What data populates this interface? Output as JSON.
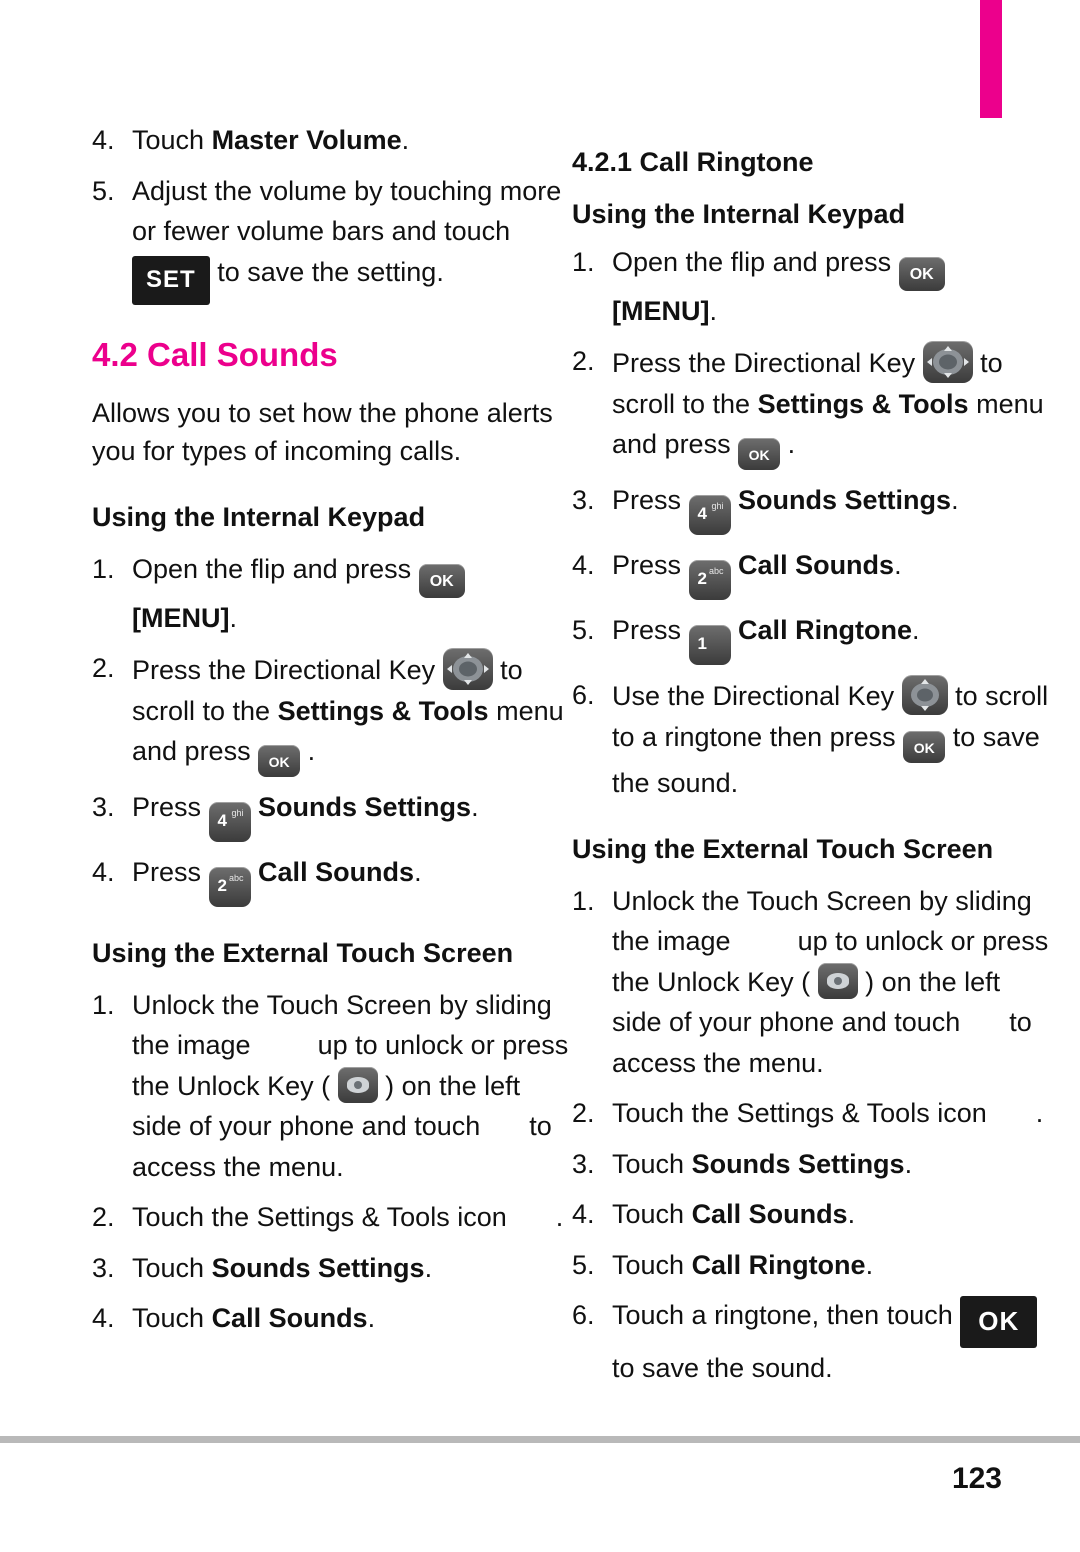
{
  "page": {
    "number": "123",
    "accent_color": "#ec008c",
    "tab_color": "#ec008c"
  },
  "left_column": {
    "steps_top": [
      {
        "num": "4.",
        "text_before": "Touch ",
        "bold": "Master Volume",
        "text_after": "."
      },
      {
        "num": "5.",
        "text_before": "Adjust the volume by touching more or fewer volume bars and touch ",
        "key": "SET",
        "text_after": " to save the setting."
      }
    ],
    "section_title": "4.2 Call Sounds",
    "intro": "Allows you to set how the phone alerts you for types of incoming calls.",
    "subhead_internal": "Using the Internal Keypad",
    "internal_steps": [
      {
        "num": "1.",
        "a": "Open the flip and press ",
        "key": "OK",
        "b": " ",
        "bold": "[MENU]",
        "c": "."
      },
      {
        "num": "2.",
        "a": "Press the Directional Key ",
        "key": "directional-key",
        "b": " to scroll to the ",
        "bold": "Settings & Tools",
        "c": " menu and press ",
        "key2": "OK",
        "d": " ."
      },
      {
        "num": "3.",
        "a": "Press ",
        "key": "4",
        "b": " ",
        "bold": "Sounds Settings",
        "c": "."
      },
      {
        "num": "4.",
        "a": "Press ",
        "key": "2",
        "b": " ",
        "bold": "Call Sounds",
        "c": "."
      }
    ],
    "subhead_external": "Using the External Touch Screen",
    "external_steps": [
      {
        "num": "1.",
        "a": "Unlock the Touch Screen by sliding the image ",
        "b": " up to unlock or press the Unlock Key ( ",
        "key": "unlock-key",
        "c": " ) on the left side of your phone and touch ",
        "d": " to access the menu."
      },
      {
        "num": "2.",
        "a": "Touch the Settings & Tools icon ",
        "b": " ."
      },
      {
        "num": "3.",
        "a": "Touch ",
        "bold": "Sounds Settings",
        "c": "."
      },
      {
        "num": "4.",
        "a": "Touch ",
        "bold": "Call Sounds",
        "c": "."
      }
    ]
  },
  "right_column": {
    "section_title": "4.2.1 Call Ringtone",
    "subhead_internal": "Using the Internal Keypad",
    "internal_steps": [
      {
        "num": "1.",
        "a": "Open the flip and press ",
        "key": "OK",
        "b": " ",
        "bold": "[MENU]",
        "c": "."
      },
      {
        "num": "2.",
        "a": "Press the Directional Key ",
        "key": "directional-key",
        "b": " to scroll to the ",
        "bold": "Settings & Tools",
        "c": " menu and press ",
        "key2": "OK",
        "d": " ."
      },
      {
        "num": "3.",
        "a": "Press ",
        "key": "4",
        "b": " ",
        "bold": "Sounds Settings",
        "c": "."
      },
      {
        "num": "4.",
        "a": "Press ",
        "key": "2",
        "b": " ",
        "bold": "Call Sounds",
        "c": "."
      },
      {
        "num": "5.",
        "a": "Press ",
        "key": "1",
        "b": " ",
        "bold": "Call Ringtone",
        "c": "."
      },
      {
        "num": "6.",
        "a": "Use the Directional Key ",
        "key": "directional-key-vertical",
        "b": " to scroll to a ringtone then press ",
        "key2": "OK",
        "c": " to save the sound."
      }
    ],
    "subhead_external": "Using the External Touch Screen",
    "external_steps": [
      {
        "num": "1.",
        "a": "Unlock the Touch Screen by sliding the image ",
        "b": " up to unlock or press the Unlock Key ( ",
        "key": "unlock-key",
        "c": " ) on the left side of your phone and touch ",
        "d": " to access the menu."
      },
      {
        "num": "2.",
        "a": "Touch the Settings & Tools icon ",
        "b": " ."
      },
      {
        "num": "3.",
        "a": "Touch ",
        "bold": "Sounds Settings",
        "c": "."
      },
      {
        "num": "4.",
        "a": "Touch ",
        "bold": "Call Sounds",
        "c": "."
      },
      {
        "num": "5.",
        "a": "Touch ",
        "bold": "Call Ringtone",
        "c": "."
      },
      {
        "num": "6.",
        "a": "Touch a ringtone, then touch ",
        "key": "OK",
        "b": " to save the sound."
      }
    ]
  },
  "keys": {
    "ok_label": "OK",
    "set_label": "SET",
    "num_4": "4",
    "num_4_sup": "ghi",
    "num_2": "2",
    "num_2_sup": "abc",
    "num_1": "1",
    "num_1_sup": "",
    "okbox_label": "OK"
  }
}
